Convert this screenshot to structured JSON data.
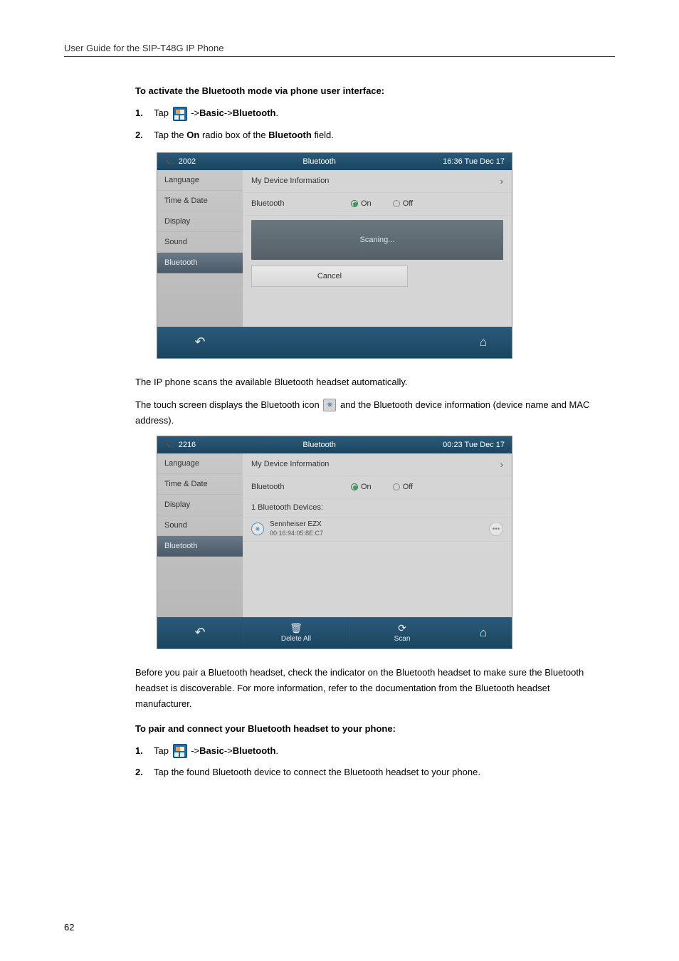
{
  "header": "User Guide for the SIP-T48G IP Phone",
  "section1_heading": "To activate the Bluetooth mode via phone user interface:",
  "steps1_1_a": "Tap ",
  "steps1_1_b": " ->",
  "steps1_1_basic": "Basic",
  "steps1_1_arrow2": "->",
  "steps1_1_bluetooth": "Bluetooth",
  "steps1_1_period": ".",
  "steps1_2_a": "Tap the ",
  "steps1_2_on": "On",
  "steps1_2_b": " radio box of the ",
  "steps1_2_bt": "Bluetooth",
  "steps1_2_c": " field.",
  "ss1": {
    "ext": "2002",
    "title": "Bluetooth",
    "time": "16:36 Tue Dec 17",
    "sidebar": [
      "Language",
      "Time & Date",
      "Display",
      "Sound",
      "Bluetooth"
    ],
    "my_device": "My Device Information",
    "bluetooth_label": "Bluetooth",
    "on": "On",
    "off": "Off",
    "scanning": "Scaning...",
    "cancel": "Cancel"
  },
  "mid1": "The IP phone scans the available Bluetooth headset automatically.",
  "mid2_a": "The touch screen displays the Bluetooth icon ",
  "mid2_b": " and the Bluetooth device information (device name and MAC address).",
  "ss2": {
    "ext": "2216",
    "title": "Bluetooth",
    "time": "00:23 Tue Dec 17",
    "sidebar": [
      "Language",
      "Time & Date",
      "Display",
      "Sound",
      "Bluetooth"
    ],
    "my_device": "My Device Information",
    "bluetooth_label": "Bluetooth",
    "on": "On",
    "off": "Off",
    "devices_count": "1 Bluetooth Devices:",
    "device_name": "Sennheiser EZX",
    "device_mac": "00:16:94:05:8E:C7",
    "delete_all": "Delete All",
    "scan": "Scan"
  },
  "para3": "Before you pair a Bluetooth headset, check the indicator on the Bluetooth headset to make sure the Bluetooth headset is discoverable. For more information, refer to the documentation from the Bluetooth headset manufacturer.",
  "section2_heading": "To pair and connect your Bluetooth headset to your phone:",
  "steps2_2": "Tap the found Bluetooth device to connect the Bluetooth headset to your phone.",
  "page_number": "62"
}
